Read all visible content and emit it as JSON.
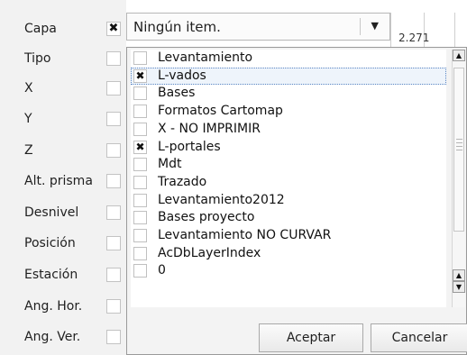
{
  "properties": [
    {
      "label": "Capa",
      "checked": true
    },
    {
      "label": "Tipo",
      "checked": false
    },
    {
      "label": "X",
      "checked": false
    },
    {
      "label": "Y",
      "checked": false
    },
    {
      "label": "Z",
      "checked": false
    },
    {
      "label": "Alt. prisma",
      "checked": false
    },
    {
      "label": "Desnivel",
      "checked": false
    },
    {
      "label": "Posición",
      "checked": false
    },
    {
      "label": "Estación",
      "checked": false
    },
    {
      "label": "Ang. Hor.",
      "checked": false
    },
    {
      "label": "Ang. Ver.",
      "checked": false
    }
  ],
  "combo": {
    "value": "Ningún item."
  },
  "background": {
    "cell_value": "2.271"
  },
  "popup": {
    "items": [
      {
        "label": "Levantamiento",
        "checked": false,
        "selected": false
      },
      {
        "label": "L-vados",
        "checked": true,
        "selected": true
      },
      {
        "label": "Bases",
        "checked": false,
        "selected": false
      },
      {
        "label": "Formatos Cartomap",
        "checked": false,
        "selected": false
      },
      {
        "label": "X - NO IMPRIMIR",
        "checked": false,
        "selected": false
      },
      {
        "label": "L-portales",
        "checked": true,
        "selected": false
      },
      {
        "label": "Mdt",
        "checked": false,
        "selected": false
      },
      {
        "label": "Trazado",
        "checked": false,
        "selected": false
      },
      {
        "label": "Levantamiento2012",
        "checked": false,
        "selected": false
      },
      {
        "label": "Bases proyecto",
        "checked": false,
        "selected": false
      },
      {
        "label": "Levantamiento NO CURVAR",
        "checked": false,
        "selected": false
      },
      {
        "label": "AcDbLayerIndex",
        "checked": false,
        "selected": false
      },
      {
        "label": "0",
        "checked": false,
        "selected": false
      }
    ],
    "accept_label": "Aceptar",
    "cancel_label": "Cancelar"
  },
  "icons": {
    "check_glyph": "✖",
    "arrow_down": "▼",
    "arrow_up": "▲"
  },
  "colors": {
    "selection_outline": "#5a86c4",
    "selection_bg": "#eef4fb"
  }
}
